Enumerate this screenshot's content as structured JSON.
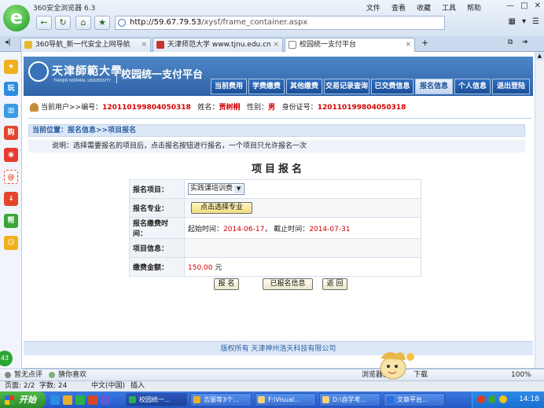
{
  "browser": {
    "app_name": "360安全浏览器 6.3",
    "menu": [
      "文件",
      "查看",
      "收藏",
      "工具",
      "帮助"
    ],
    "address_host": "http://59.67.79.53",
    "address_path": "/xysf/frame_container.aspx",
    "tabs": [
      {
        "label": "360导航_新一代安全上网导航",
        "close": "×"
      },
      {
        "label": "天津师范大学 www.tjnu.edu.cn",
        "close": "×"
      },
      {
        "label": "校园统一支付平台",
        "close": "×"
      }
    ],
    "new_tab": "+",
    "bottom": {
      "left1": "暂无点评",
      "left2": "猜你喜欢",
      "right1": "浏览器医生",
      "right2": "下载",
      "zoom": "100%"
    }
  },
  "sidebar": {
    "icons": [
      "收藏",
      "玩",
      "书",
      "购",
      "微博",
      "@",
      "下载",
      "帮",
      "笑"
    ],
    "badge": "43"
  },
  "site": {
    "university": "天津師範大學",
    "university_en": "TIANJIN NORMAL UNIVERSITY",
    "system_name": "校园统一支付平台",
    "nav": [
      "当前费用",
      "学费缴费",
      "其他缴费",
      "交易记录查询",
      "已交费信息",
      "报名信息",
      "个人信息",
      "退出登陆"
    ],
    "active_nav": "报名信息"
  },
  "user": {
    "prefix": "当前用户>>编号：",
    "id": "120110199804050318",
    "name_label": "姓名：",
    "name": "贾树桐",
    "gender_label": "性别：",
    "gender": "男",
    "idcard_label": "身份证号：",
    "idcard": "120110199804050318"
  },
  "breadcrumb": "当前位置：报名信息>>项目报名",
  "note": "说明：选择需要报名的项目后，点击报名按钮进行报名，一个项目只允许报名一次",
  "form": {
    "title": "项目报名",
    "project_label": "报名项目：",
    "project_value": "实践课培训费",
    "major_label": "报名专业：",
    "major_button": "点击选择专业",
    "period_label": "报名缴费时间：",
    "start_label": "起始时间：",
    "start_date": "2014-06-17",
    "sep": "，",
    "end_label": "截止时间：",
    "end_date": "2014-07-31",
    "info_label": "项目信息：",
    "amount_label": "缴费金额：",
    "amount": "150.00",
    "unit": "元"
  },
  "actions": {
    "submit": "报 名",
    "registered": "已报名信息",
    "back": "返 回"
  },
  "footer": "版权所有 天津神州浩天科技有限公司",
  "word_status": {
    "page": "页面: 2/2",
    "words": "字数: 24",
    "lang": "中文(中国)",
    "insert": "插入"
  },
  "taskbar": {
    "start": "开始",
    "items": [
      "校园统一...",
      "吉丽等3个...",
      "F:\\Visual...",
      "D:\\自学考...",
      "文章平台..."
    ],
    "clock": "14:18"
  }
}
